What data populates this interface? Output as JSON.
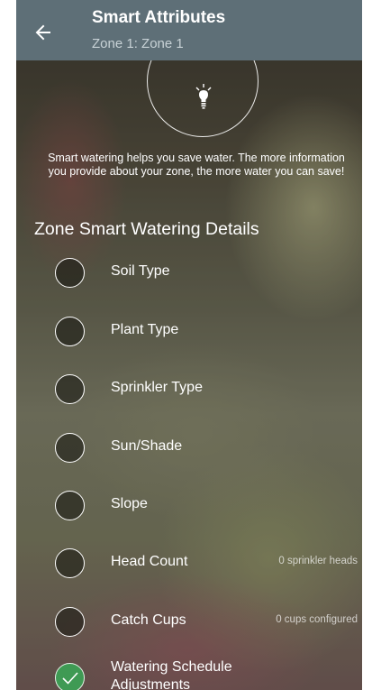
{
  "header": {
    "title": "Smart Attributes",
    "subtitle": "Zone 1: Zone 1",
    "background_color": "#5e6f77",
    "back_icon": "arrow-left-icon"
  },
  "intro": {
    "icon": "lightbulb-icon",
    "text": "Smart watering helps you save water. The more information you provide about your zone, the more water you can save!"
  },
  "details": {
    "heading": "Zone Smart Watering Details",
    "items": [
      {
        "label": "Soil Type",
        "value": "",
        "completed": false
      },
      {
        "label": "Plant Type",
        "value": "",
        "completed": false
      },
      {
        "label": "Sprinkler Type",
        "value": "",
        "completed": false
      },
      {
        "label": "Sun/Shade",
        "value": "",
        "completed": false
      },
      {
        "label": "Slope",
        "value": "",
        "completed": false
      },
      {
        "label": "Head Count",
        "value": "0 sprinkler heads",
        "completed": false
      },
      {
        "label": "Catch Cups",
        "value": "0 cups configured",
        "completed": false
      },
      {
        "label": "Watering Schedule Adjustments",
        "value": "",
        "completed": true
      }
    ],
    "completed_color": "#3f9a54"
  }
}
